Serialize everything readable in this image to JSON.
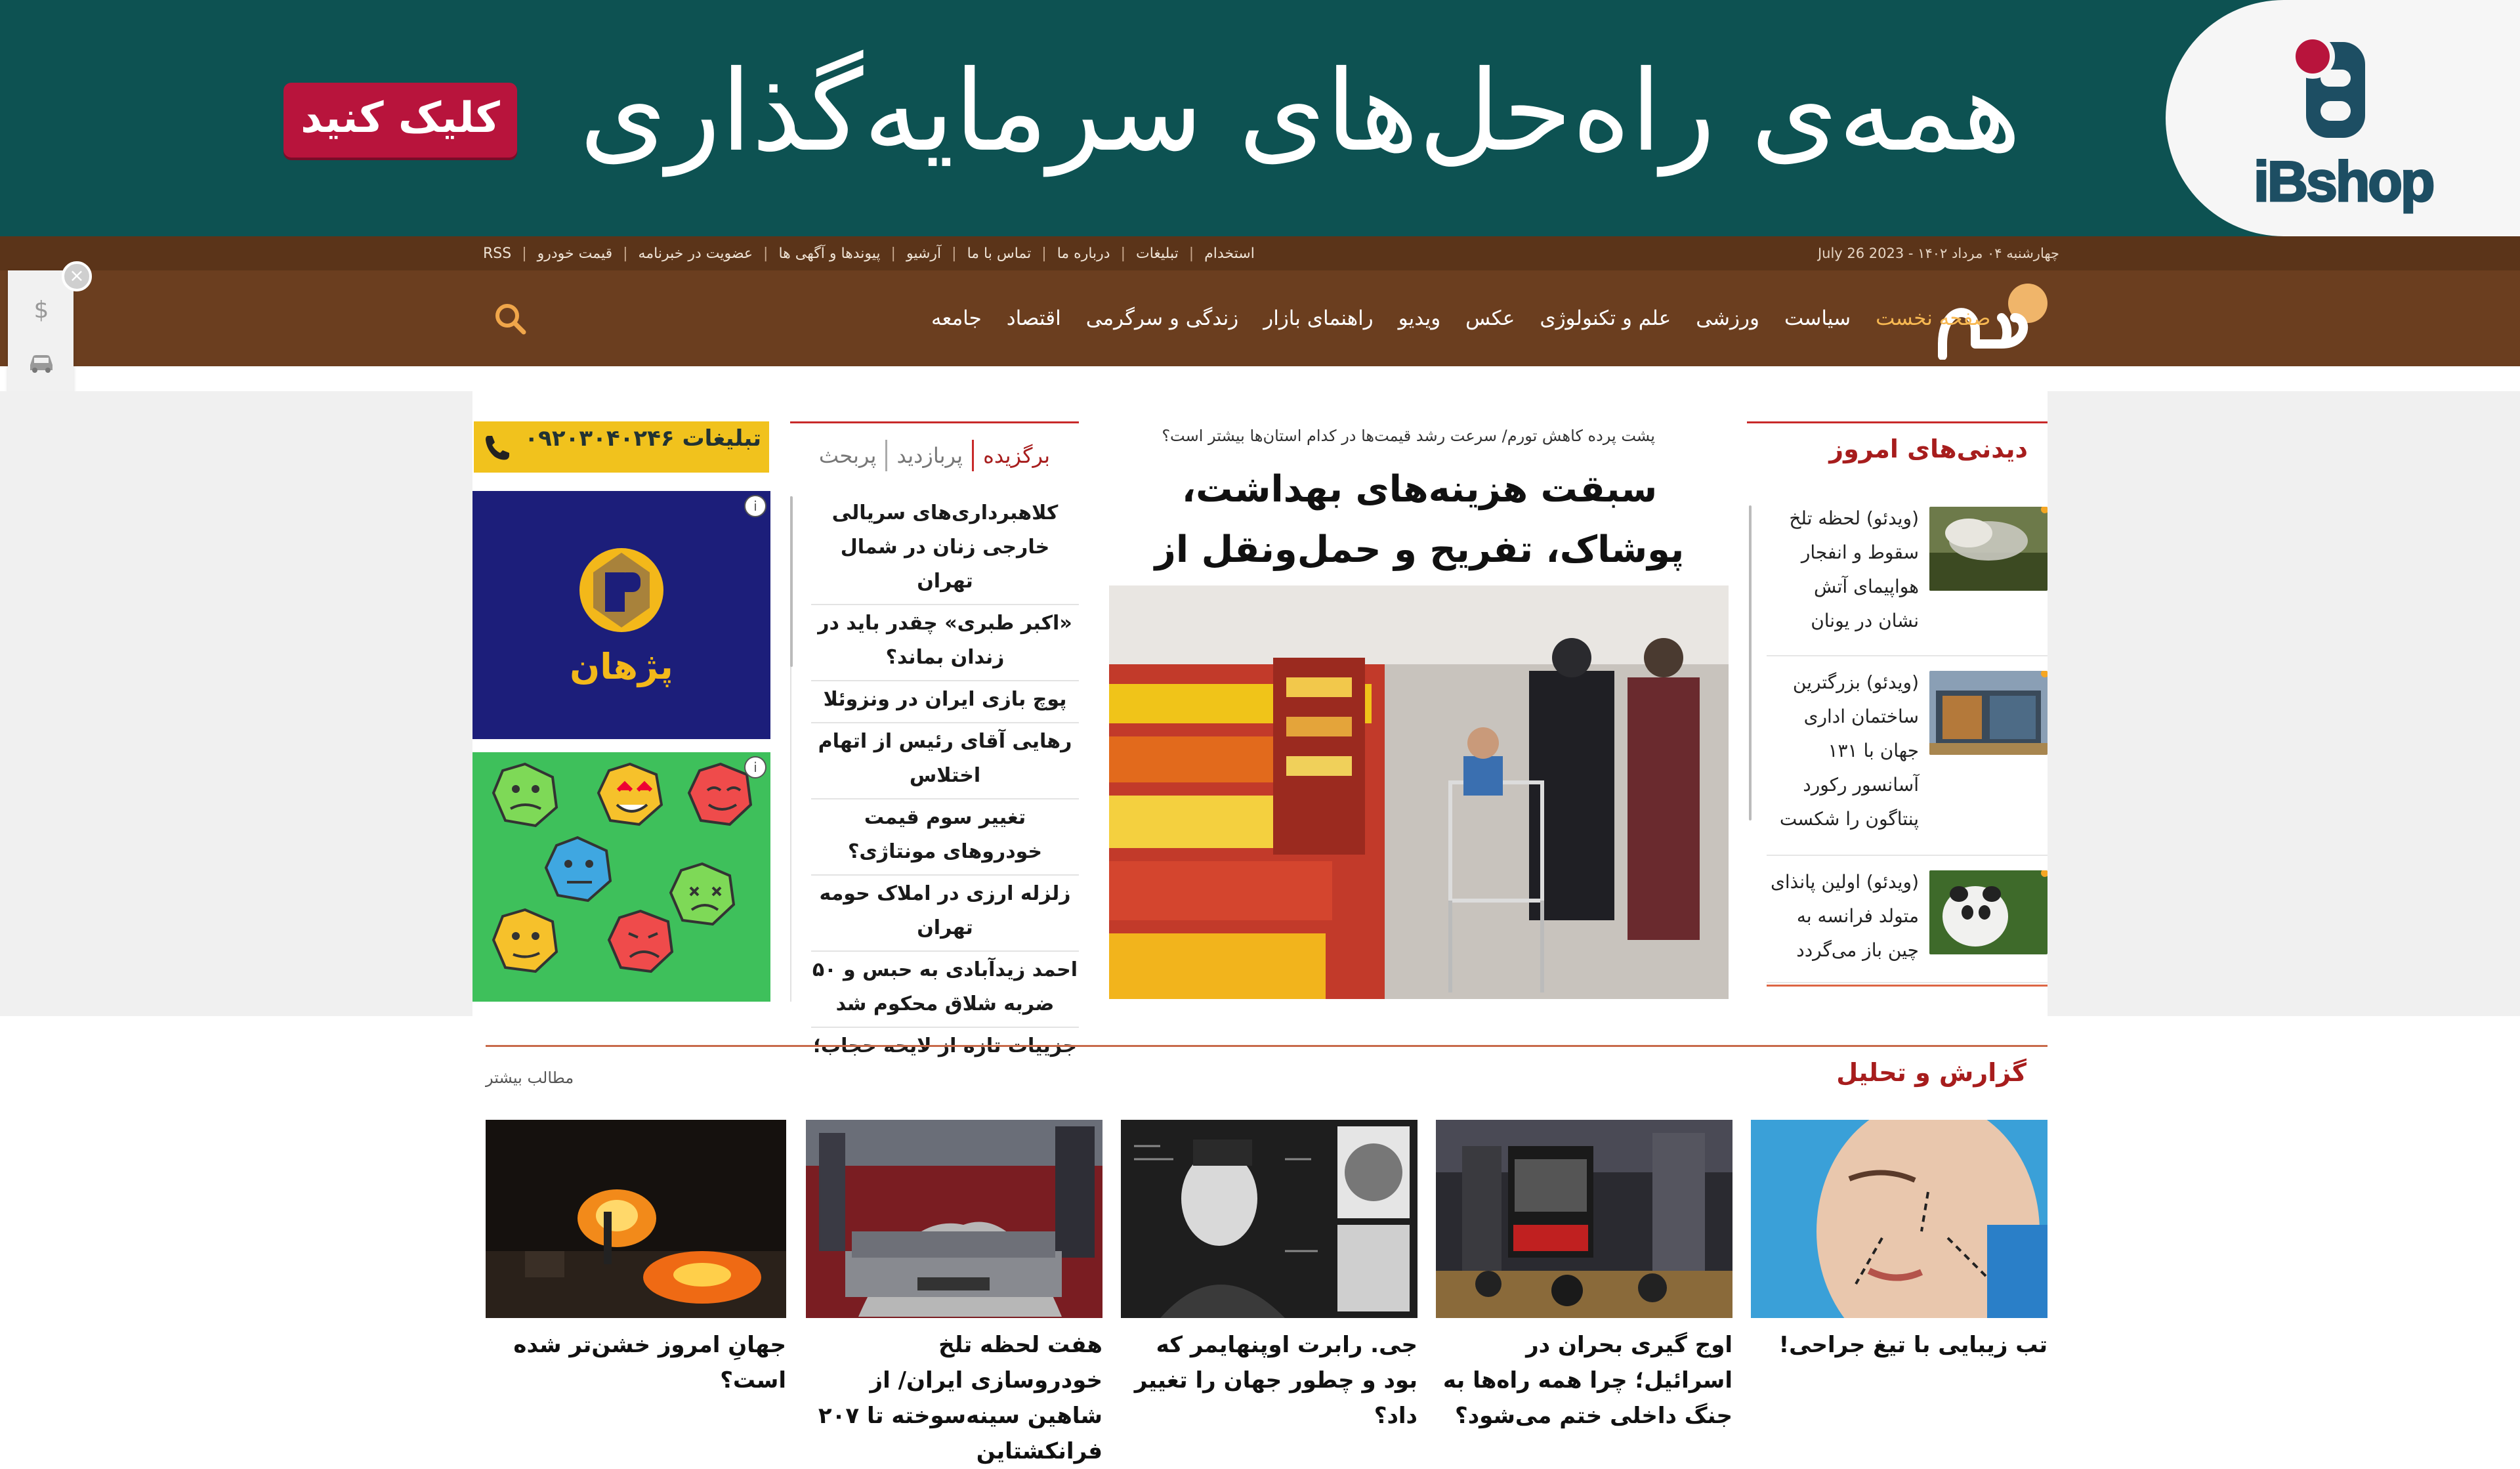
{
  "colors": {
    "banner_bg": "#0d5252",
    "cta_bg": "#b8143c",
    "topbar_bg": "#5b3419",
    "nav_bg": "#6b3e1f",
    "nav_active": "#f7b852",
    "section_red": "#a71d1d",
    "ad_phone_bg": "#f1c21d",
    "ad_pezhan_bg": "#1c1e7a",
    "ad_emoji_bg": "#3ec05b"
  },
  "banner": {
    "headline": "همه‌ی راه‌حل‌های سرمایه‌گذاری",
    "cta": "کلیک کنید",
    "brand": "iBshop"
  },
  "topbar": {
    "date": "چهارشنبه ۰۴ مرداد ۱۴۰۲ - July 26 2023",
    "links": [
      "استخدام",
      "تبلیغات",
      "درباره ما",
      "تماس با ما",
      "آرشیو",
      "پیوندها و آگهی ها",
      "عضویت در خبرنامه",
      "قیمت خودرو",
      "RSS"
    ]
  },
  "nav": {
    "items": [
      "صفحه نخست",
      "سیاست",
      "ورزشی",
      "علم و تکنولوژی",
      "عکس",
      "ویدیو",
      "راهنمای بازار",
      "زندگی و سرگرمی",
      "اقتصاد",
      "جامعه"
    ],
    "search_icon": "search-icon"
  },
  "side_widget": {
    "icons": [
      "dollar-icon",
      "car-icon",
      "mobile-icon"
    ],
    "close": "×"
  },
  "didani": {
    "title": "دیدنی‌های امروز",
    "items": [
      "(ویدئو) لحظه تلخ سقوط و انفجار هواپیمای آتش نشان در یونان",
      "(ویدئو) بزرگترین ساختمان اداری جهان با ۱۳۱ آسانسور رکورد پنتاگون را شکست",
      "(ویدئو) اولین پانذای متولد فرانسه به چین باز می‌گردد"
    ]
  },
  "lead": {
    "kicker": "پشت پرده کاهش تورم/ سرعت رشد قیمت‌ها در کدام استان‌ها بیشتر است؟",
    "headline": "سبقت هزینه‌های بهداشت، پوشاک، تفریح و حمل‌ونقل از تورم عمومی"
  },
  "tabs": {
    "items": [
      "برگزیده",
      "پربازدید",
      "پربحث"
    ],
    "active": "برگزیده"
  },
  "news_list": [
    "کلاهبرداری‌های سریالی خارجی زنان در شمال تهران",
    "«اکبر طبری» چقدر باید در زندان بماند؟",
    "پوچ بازی ایران در ونزوئلا",
    "رهایی آقای رئیس از اتهام اختلاس",
    "تغییر سوم قیمت خودروهای مونتاژی؟",
    "زلزله ارزی در املاک حومه تهران",
    "احمد زیدآبادی به حبس و ۵۰ ضربه شلاق محکوم شد",
    "جزییات تازه از لایحه حجاب؛"
  ],
  "ads": {
    "phone_label": "تبلیغات ۰۹۲۰۳۰۴۰۲۴۶",
    "pezhan_label": "پژهان",
    "badge": "i"
  },
  "report": {
    "title": "گزارش و تحلیل",
    "more": "مطالب بیشتر",
    "cards": [
      "تب زیبایی با تیغ جراحی!",
      "اوج گیری بحران در اسرائیل؛ چرا همه راه‌ها به جنگ داخلی ختم می‌شود؟",
      "جی. رابرت اوپنهایمر که بود و چطور جهان را تغییر داد؟",
      "هفت لحظه تلخ خودروسازی ایران/ از شاهین سینه‌سوخته تا ۲۰۷ فرانکشتاین",
      "جهانِ امروز خشن‌تر شده است؟"
    ]
  }
}
